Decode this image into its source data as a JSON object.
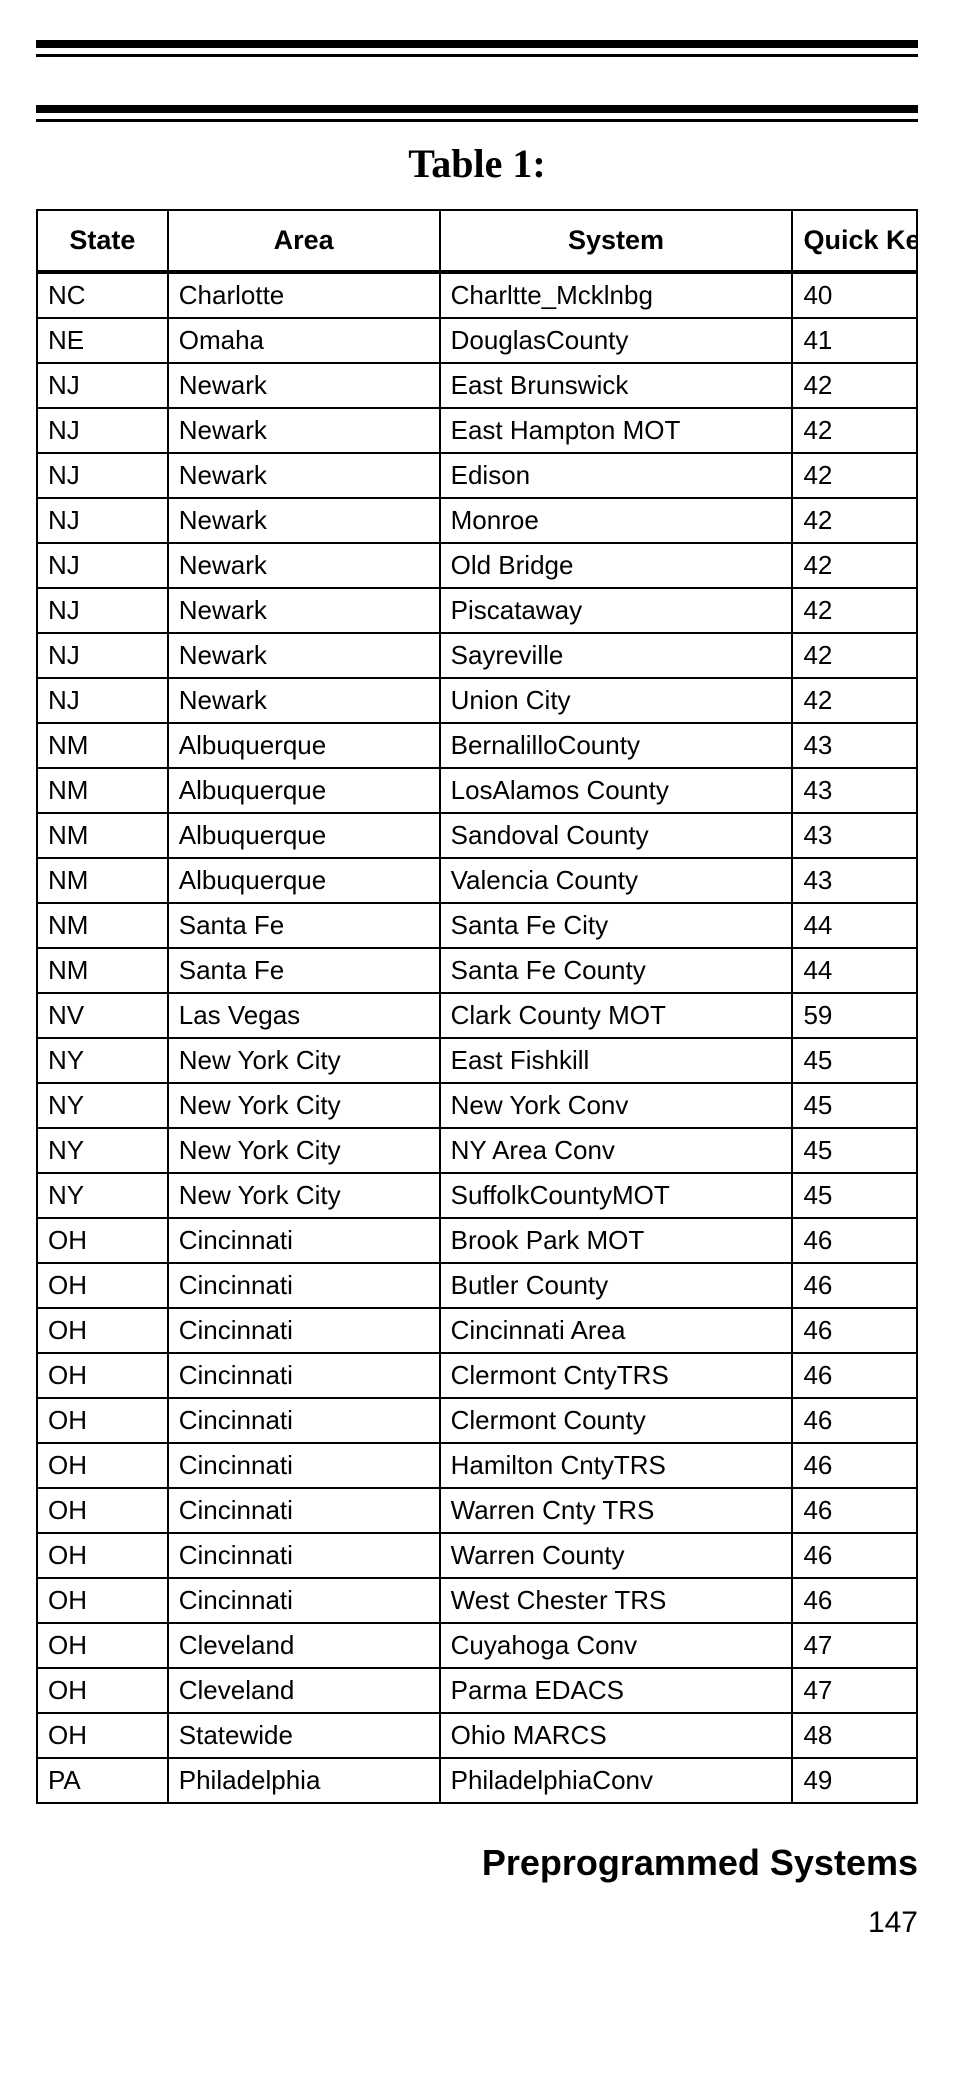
{
  "title": "Table 1:",
  "columns": [
    "State",
    "Area",
    "System",
    "Quick Key"
  ],
  "rows": [
    {
      "state": "NC",
      "area": "Charlotte",
      "system": "Charltte_Mcklnbg",
      "key": "40"
    },
    {
      "state": "NE",
      "area": "Omaha",
      "system": "DouglasCounty",
      "key": "41"
    },
    {
      "state": "NJ",
      "area": "Newark",
      "system": "East Brunswick",
      "key": "42"
    },
    {
      "state": "NJ",
      "area": "Newark",
      "system": "East Hampton MOT",
      "key": "42"
    },
    {
      "state": "NJ",
      "area": "Newark",
      "system": "Edison",
      "key": "42"
    },
    {
      "state": "NJ",
      "area": "Newark",
      "system": "Monroe",
      "key": "42"
    },
    {
      "state": "NJ",
      "area": "Newark",
      "system": "Old Bridge",
      "key": "42"
    },
    {
      "state": "NJ",
      "area": "Newark",
      "system": "Piscataway",
      "key": "42"
    },
    {
      "state": "NJ",
      "area": "Newark",
      "system": "Sayreville",
      "key": "42"
    },
    {
      "state": "NJ",
      "area": "Newark",
      "system": "Union City",
      "key": "42"
    },
    {
      "state": "NM",
      "area": "Albuquerque",
      "system": "BernalilloCounty",
      "key": "43"
    },
    {
      "state": "NM",
      "area": "Albuquerque",
      "system": "LosAlamos County",
      "key": "43"
    },
    {
      "state": "NM",
      "area": "Albuquerque",
      "system": "Sandoval County",
      "key": "43"
    },
    {
      "state": "NM",
      "area": "Albuquerque",
      "system": "Valencia County",
      "key": "43"
    },
    {
      "state": "NM",
      "area": "Santa Fe",
      "system": "Santa Fe City",
      "key": "44"
    },
    {
      "state": "NM",
      "area": "Santa Fe",
      "system": "Santa Fe County",
      "key": "44"
    },
    {
      "state": "NV",
      "area": "Las Vegas",
      "system": "Clark County MOT",
      "key": "59"
    },
    {
      "state": "NY",
      "area": "New York City",
      "system": "East Fishkill",
      "key": "45"
    },
    {
      "state": "NY",
      "area": "New York City",
      "system": "New York Conv",
      "key": "45"
    },
    {
      "state": "NY",
      "area": "New York City",
      "system": "NY Area Conv",
      "key": "45"
    },
    {
      "state": "NY",
      "area": "New York City",
      "system": "SuffolkCountyMOT",
      "key": "45"
    },
    {
      "state": "OH",
      "area": "Cincinnati",
      "system": "Brook Park MOT",
      "key": "46"
    },
    {
      "state": "OH",
      "area": "Cincinnati",
      "system": "Butler County",
      "key": "46"
    },
    {
      "state": "OH",
      "area": "Cincinnati",
      "system": "Cincinnati Area",
      "key": "46"
    },
    {
      "state": "OH",
      "area": "Cincinnati",
      "system": "Clermont CntyTRS",
      "key": "46"
    },
    {
      "state": "OH",
      "area": "Cincinnati",
      "system": "Clermont County",
      "key": "46"
    },
    {
      "state": "OH",
      "area": "Cincinnati",
      "system": "Hamilton CntyTRS",
      "key": "46"
    },
    {
      "state": "OH",
      "area": "Cincinnati",
      "system": "Warren Cnty TRS",
      "key": "46"
    },
    {
      "state": "OH",
      "area": "Cincinnati",
      "system": "Warren County",
      "key": "46"
    },
    {
      "state": "OH",
      "area": "Cincinnati",
      "system": "West Chester TRS",
      "key": "46"
    },
    {
      "state": "OH",
      "area": "Cleveland",
      "system": "Cuyahoga Conv",
      "key": "47"
    },
    {
      "state": "OH",
      "area": "Cleveland",
      "system": "Parma EDACS",
      "key": "47"
    },
    {
      "state": "OH",
      "area": "Statewide",
      "system": "Ohio MARCS",
      "key": "48"
    },
    {
      "state": "PA",
      "area": "Philadelphia",
      "system": "PhiladelphiaConv",
      "key": "49"
    }
  ],
  "section_heading": "Preprogrammed Systems",
  "page_number": "147"
}
